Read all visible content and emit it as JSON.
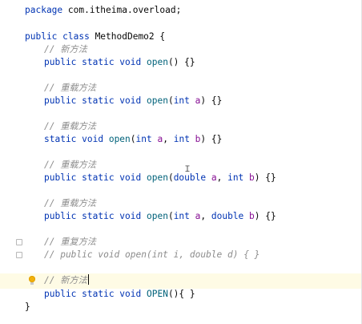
{
  "code": {
    "package_kw": "package",
    "package_name": " com.itheima.overload;",
    "class_line": {
      "mods": "public class ",
      "name": "MethodDemo2",
      "rest": " {"
    },
    "m1": {
      "comment": "// 新方法",
      "mods": "public static void ",
      "name": "open",
      "rest": "() {}"
    },
    "m2": {
      "comment": "// 重载方法",
      "mods": "public static void ",
      "name": "open",
      "p_open": "(",
      "type1": "int",
      "var1": " a",
      "rest": ") {}"
    },
    "m3": {
      "comment": "// 重载方法",
      "mods": "static void ",
      "name": "open",
      "p_open": "(",
      "type1": "int",
      "var1": " a",
      "sep": ", ",
      "type2": "int",
      "var2": " b",
      "rest": ") {}"
    },
    "m4": {
      "comment": "// 重载方法",
      "mods": "public static void ",
      "name": "open",
      "p_open": "(",
      "type1": "double",
      "var1": " a",
      "sep": ", ",
      "type2": "int",
      "var2": " b",
      "rest": ") {}"
    },
    "m5": {
      "comment": "// 重载方法",
      "mods": "public static void ",
      "name": "open",
      "p_open": "(",
      "type1": "int",
      "var1": " a",
      "sep": ", ",
      "type2": "double",
      "var2": " b",
      "rest": ") {}"
    },
    "m6": {
      "comment": "// 重复方法",
      "code_comment": "// public void open(int i, double d) { }"
    },
    "m7": {
      "comment": "// 新方法",
      "mods": "public static void ",
      "name": "OPEN",
      "rest": "(){ }"
    },
    "closing": "}"
  }
}
